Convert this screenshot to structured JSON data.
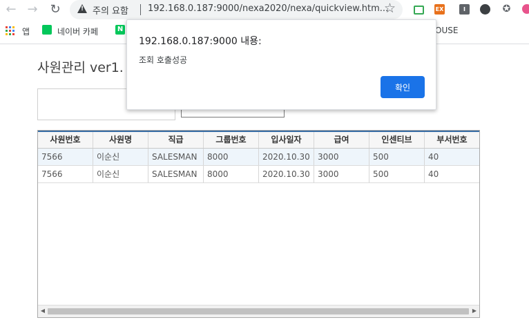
{
  "browser": {
    "security_label": "주의 요함",
    "url": "192.168.0.187:9000/nexa2020/nexa/quickview.htm...",
    "back_icon": "arrow-left-icon",
    "forward_icon": "arrow-right-icon",
    "reload_icon": "reload-icon",
    "extension_badges": [
      "EX",
      "I"
    ]
  },
  "bookmarks": {
    "apps_label": "앱",
    "items": [
      "네이버 카페",
      "N"
    ],
    "partial_item": "OUSE"
  },
  "page": {
    "title": "사원관리 ver1."
  },
  "grid": {
    "columns": [
      "사원번호",
      "사원명",
      "직급",
      "그룹번호",
      "입사일자",
      "급여",
      "인센티브",
      "부서번호"
    ],
    "rows": [
      [
        "7566",
        "이순신",
        "SALESMAN",
        "8000",
        "2020.10.30",
        "3000",
        "500",
        "40"
      ],
      [
        "7566",
        "이순신",
        "SALESMAN",
        "8000",
        "2020.10.30",
        "3000",
        "500",
        "40"
      ]
    ]
  },
  "dialog": {
    "title": "192.168.0.187:9000 내용:",
    "message": "조회 호출성공",
    "ok_label": "확인"
  },
  "colors": {
    "accent": "#1a73e8",
    "grid_header_line": "#3a6ea5"
  }
}
